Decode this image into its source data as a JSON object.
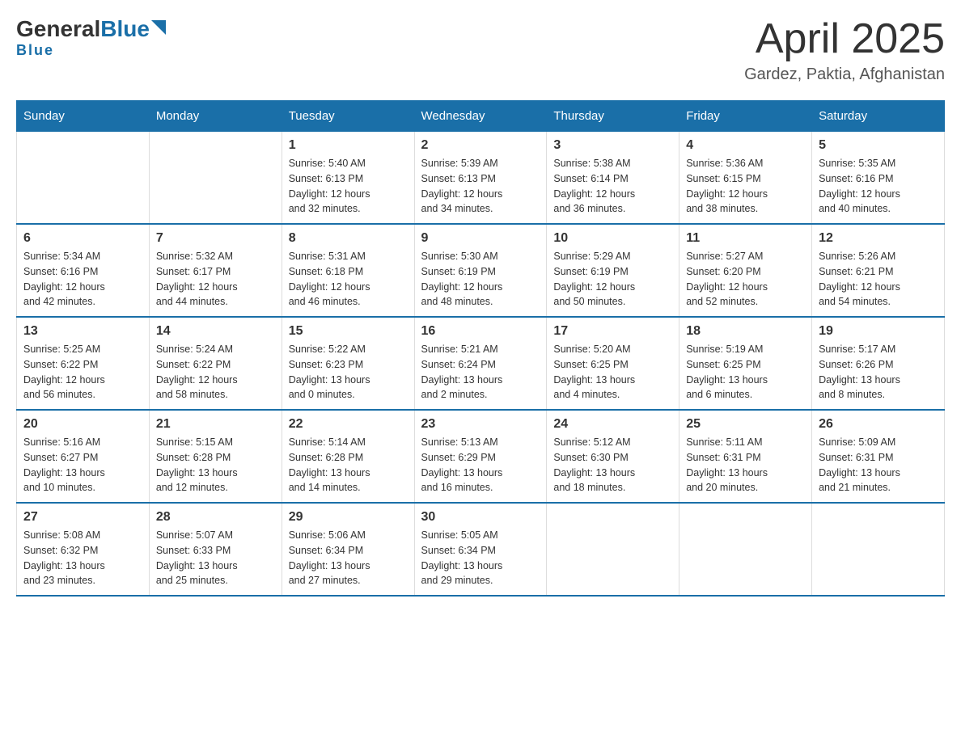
{
  "header": {
    "logo_general": "General",
    "logo_blue": "Blue",
    "title": "April 2025",
    "subtitle": "Gardez, Paktia, Afghanistan"
  },
  "weekdays": [
    "Sunday",
    "Monday",
    "Tuesday",
    "Wednesday",
    "Thursday",
    "Friday",
    "Saturday"
  ],
  "weeks": [
    [
      {
        "day": "",
        "info": ""
      },
      {
        "day": "",
        "info": ""
      },
      {
        "day": "1",
        "info": "Sunrise: 5:40 AM\nSunset: 6:13 PM\nDaylight: 12 hours\nand 32 minutes."
      },
      {
        "day": "2",
        "info": "Sunrise: 5:39 AM\nSunset: 6:13 PM\nDaylight: 12 hours\nand 34 minutes."
      },
      {
        "day": "3",
        "info": "Sunrise: 5:38 AM\nSunset: 6:14 PM\nDaylight: 12 hours\nand 36 minutes."
      },
      {
        "day": "4",
        "info": "Sunrise: 5:36 AM\nSunset: 6:15 PM\nDaylight: 12 hours\nand 38 minutes."
      },
      {
        "day": "5",
        "info": "Sunrise: 5:35 AM\nSunset: 6:16 PM\nDaylight: 12 hours\nand 40 minutes."
      }
    ],
    [
      {
        "day": "6",
        "info": "Sunrise: 5:34 AM\nSunset: 6:16 PM\nDaylight: 12 hours\nand 42 minutes."
      },
      {
        "day": "7",
        "info": "Sunrise: 5:32 AM\nSunset: 6:17 PM\nDaylight: 12 hours\nand 44 minutes."
      },
      {
        "day": "8",
        "info": "Sunrise: 5:31 AM\nSunset: 6:18 PM\nDaylight: 12 hours\nand 46 minutes."
      },
      {
        "day": "9",
        "info": "Sunrise: 5:30 AM\nSunset: 6:19 PM\nDaylight: 12 hours\nand 48 minutes."
      },
      {
        "day": "10",
        "info": "Sunrise: 5:29 AM\nSunset: 6:19 PM\nDaylight: 12 hours\nand 50 minutes."
      },
      {
        "day": "11",
        "info": "Sunrise: 5:27 AM\nSunset: 6:20 PM\nDaylight: 12 hours\nand 52 minutes."
      },
      {
        "day": "12",
        "info": "Sunrise: 5:26 AM\nSunset: 6:21 PM\nDaylight: 12 hours\nand 54 minutes."
      }
    ],
    [
      {
        "day": "13",
        "info": "Sunrise: 5:25 AM\nSunset: 6:22 PM\nDaylight: 12 hours\nand 56 minutes."
      },
      {
        "day": "14",
        "info": "Sunrise: 5:24 AM\nSunset: 6:22 PM\nDaylight: 12 hours\nand 58 minutes."
      },
      {
        "day": "15",
        "info": "Sunrise: 5:22 AM\nSunset: 6:23 PM\nDaylight: 13 hours\nand 0 minutes."
      },
      {
        "day": "16",
        "info": "Sunrise: 5:21 AM\nSunset: 6:24 PM\nDaylight: 13 hours\nand 2 minutes."
      },
      {
        "day": "17",
        "info": "Sunrise: 5:20 AM\nSunset: 6:25 PM\nDaylight: 13 hours\nand 4 minutes."
      },
      {
        "day": "18",
        "info": "Sunrise: 5:19 AM\nSunset: 6:25 PM\nDaylight: 13 hours\nand 6 minutes."
      },
      {
        "day": "19",
        "info": "Sunrise: 5:17 AM\nSunset: 6:26 PM\nDaylight: 13 hours\nand 8 minutes."
      }
    ],
    [
      {
        "day": "20",
        "info": "Sunrise: 5:16 AM\nSunset: 6:27 PM\nDaylight: 13 hours\nand 10 minutes."
      },
      {
        "day": "21",
        "info": "Sunrise: 5:15 AM\nSunset: 6:28 PM\nDaylight: 13 hours\nand 12 minutes."
      },
      {
        "day": "22",
        "info": "Sunrise: 5:14 AM\nSunset: 6:28 PM\nDaylight: 13 hours\nand 14 minutes."
      },
      {
        "day": "23",
        "info": "Sunrise: 5:13 AM\nSunset: 6:29 PM\nDaylight: 13 hours\nand 16 minutes."
      },
      {
        "day": "24",
        "info": "Sunrise: 5:12 AM\nSunset: 6:30 PM\nDaylight: 13 hours\nand 18 minutes."
      },
      {
        "day": "25",
        "info": "Sunrise: 5:11 AM\nSunset: 6:31 PM\nDaylight: 13 hours\nand 20 minutes."
      },
      {
        "day": "26",
        "info": "Sunrise: 5:09 AM\nSunset: 6:31 PM\nDaylight: 13 hours\nand 21 minutes."
      }
    ],
    [
      {
        "day": "27",
        "info": "Sunrise: 5:08 AM\nSunset: 6:32 PM\nDaylight: 13 hours\nand 23 minutes."
      },
      {
        "day": "28",
        "info": "Sunrise: 5:07 AM\nSunset: 6:33 PM\nDaylight: 13 hours\nand 25 minutes."
      },
      {
        "day": "29",
        "info": "Sunrise: 5:06 AM\nSunset: 6:34 PM\nDaylight: 13 hours\nand 27 minutes."
      },
      {
        "day": "30",
        "info": "Sunrise: 5:05 AM\nSunset: 6:34 PM\nDaylight: 13 hours\nand 29 minutes."
      },
      {
        "day": "",
        "info": ""
      },
      {
        "day": "",
        "info": ""
      },
      {
        "day": "",
        "info": ""
      }
    ]
  ]
}
